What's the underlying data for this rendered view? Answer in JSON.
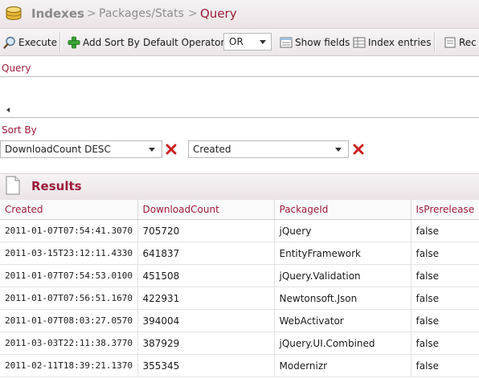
{
  "breadcrumb": {
    "root": "Indexes",
    "separator": ">",
    "index": "Packages/Stats",
    "current": "Query"
  },
  "toolbar": {
    "execute_label": "Execute",
    "add_sort_label": "Add Sort By",
    "operator_label": "Default Operator:",
    "operator_value": "OR",
    "show_fields_label": "Show fields",
    "index_entries_label": "Index entries",
    "recent_label": "Rec"
  },
  "query": {
    "label": "Query",
    "value": ""
  },
  "sort": {
    "label": "Sort By",
    "fields": [
      "DownloadCount DESC",
      "Created"
    ]
  },
  "results": {
    "title": "Results",
    "columns": [
      "Created",
      "DownloadCount",
      "PackageId",
      "IsPrerelease"
    ],
    "rows": [
      [
        "2011-01-07T07:54:41.3070",
        "705720",
        "jQuery",
        "false"
      ],
      [
        "2011-03-15T23:12:11.4330",
        "641837",
        "EntityFramework",
        "false"
      ],
      [
        "2011-01-07T07:54:53.0100",
        "451508",
        "jQuery.Validation",
        "false"
      ],
      [
        "2011-01-07T07:56:51.1670",
        "422931",
        "Newtonsoft.Json",
        "false"
      ],
      [
        "2011-01-07T08:03:27.0570",
        "394004",
        "WebActivator",
        "false"
      ],
      [
        "2011-03-03T22:11:38.3770",
        "387929",
        "jQuery.UI.Combined",
        "false"
      ],
      [
        "2011-02-11T18:39:21.1370",
        "355345",
        "Modernizr",
        "false"
      ]
    ]
  },
  "colors": {
    "accent": "#9b1b3a",
    "add_green": "#3aa335",
    "remove_red": "#cc2020"
  },
  "icons": {
    "database": "database-icon",
    "execute": "execute-icon",
    "add_sort": "plus-icon",
    "show_fields": "fields-icon",
    "index_entries": "index-entries-icon",
    "remove": "remove-x-icon",
    "results": "document-icon"
  }
}
